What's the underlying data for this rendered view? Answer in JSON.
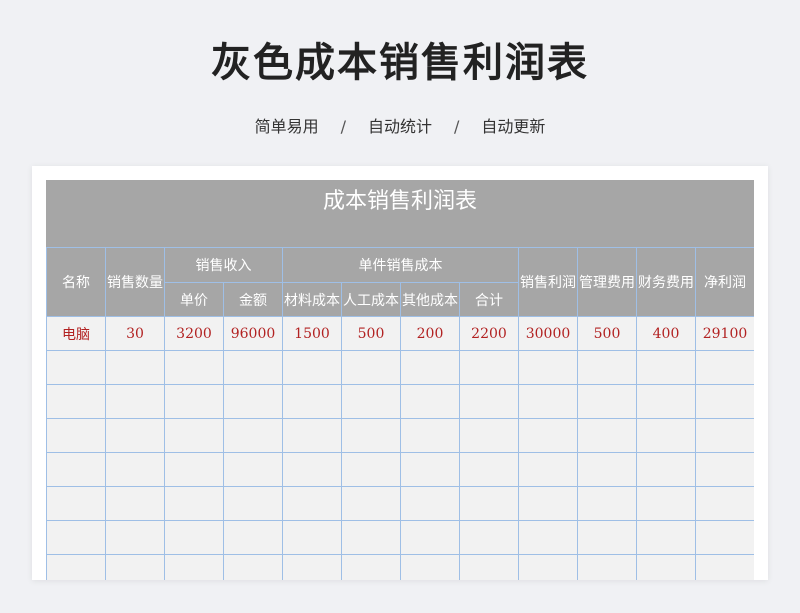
{
  "header": {
    "title": "灰色成本销售利润表",
    "tags": [
      "简单易用",
      "自动统计",
      "自动更新"
    ],
    "separator": "/"
  },
  "sheet": {
    "title": "成本销售利润表",
    "columns": {
      "name": "名称",
      "qty": "销售数量",
      "revenue_group": "销售收入",
      "unit_price": "单价",
      "amount": "金额",
      "unit_cost_group": "单件销售成本",
      "material_cost": "材料成本",
      "labor_cost": "人工成本",
      "other_cost": "其他成本",
      "subtotal": "合计",
      "sales_profit": "销售利润",
      "mgmt_fee": "管理费用",
      "finance_fee": "财务费用",
      "net_profit": "净利润"
    },
    "rows": [
      [
        "电脑",
        "30",
        "3200",
        "96000",
        "1500",
        "500",
        "200",
        "2200",
        "30000",
        "500",
        "400",
        "29100"
      ],
      [
        "",
        "",
        "",
        "",
        "",
        "",
        "",
        "",
        "",
        "",
        "",
        ""
      ],
      [
        "",
        "",
        "",
        "",
        "",
        "",
        "",
        "",
        "",
        "",
        "",
        ""
      ],
      [
        "",
        "",
        "",
        "",
        "",
        "",
        "",
        "",
        "",
        "",
        "",
        ""
      ],
      [
        "",
        "",
        "",
        "",
        "",
        "",
        "",
        "",
        "",
        "",
        "",
        ""
      ],
      [
        "",
        "",
        "",
        "",
        "",
        "",
        "",
        "",
        "",
        "",
        "",
        ""
      ],
      [
        "",
        "",
        "",
        "",
        "",
        "",
        "",
        "",
        "",
        "",
        "",
        ""
      ],
      [
        "",
        "",
        "",
        "",
        "",
        "",
        "",
        "",
        "",
        "",
        "",
        ""
      ]
    ]
  }
}
